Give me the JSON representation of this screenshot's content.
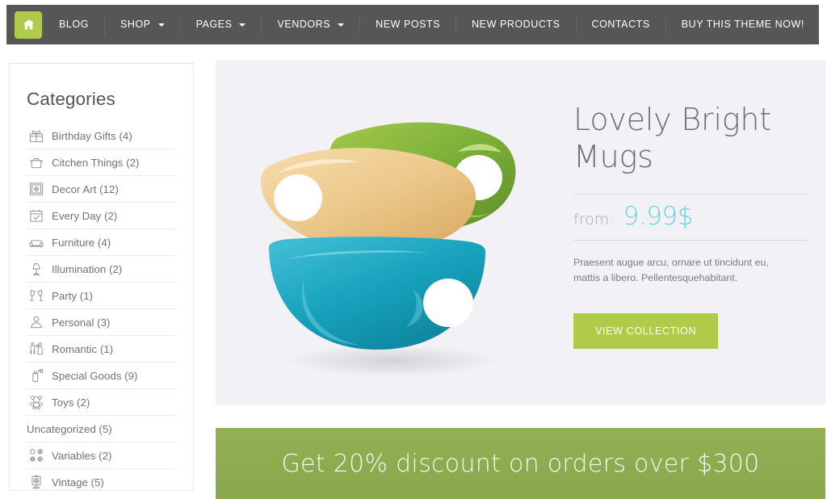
{
  "nav": {
    "home_icon": "home-icon",
    "items": [
      {
        "label": "BLOG",
        "has_dropdown": false
      },
      {
        "label": "SHOP",
        "has_dropdown": true
      },
      {
        "label": "PAGES",
        "has_dropdown": true
      },
      {
        "label": "VENDORS",
        "has_dropdown": true
      },
      {
        "label": "NEW POSTS",
        "has_dropdown": false
      },
      {
        "label": "NEW PRODUCTS",
        "has_dropdown": false
      },
      {
        "label": "CONTACTS",
        "has_dropdown": false
      },
      {
        "label": "BUY THIS THEME NOW!",
        "has_dropdown": false
      }
    ]
  },
  "sidebar": {
    "title": "Categories",
    "categories": [
      {
        "label": "Birthday Gifts (4)",
        "icon": "gift-icon"
      },
      {
        "label": "Citchen Things (2)",
        "icon": "pot-icon"
      },
      {
        "label": "Decor Art (12)",
        "icon": "framed-picture-icon"
      },
      {
        "label": "Every Day (2)",
        "icon": "calendar-check-icon"
      },
      {
        "label": "Furniture (4)",
        "icon": "sofa-icon"
      },
      {
        "label": "Illumination (2)",
        "icon": "table-lamp-icon"
      },
      {
        "label": "Party (1)",
        "icon": "cheers-glasses-icon"
      },
      {
        "label": "Personal (3)",
        "icon": "person-icon"
      },
      {
        "label": "Romantic (1)",
        "icon": "couple-icon"
      },
      {
        "label": "Special Goods (9)",
        "icon": "spray-can-icon"
      },
      {
        "label": "Toys (2)",
        "icon": "teddy-bear-icon"
      },
      {
        "label": "Uncategorized (5)",
        "icon": ""
      },
      {
        "label": "Variables (2)",
        "icon": "color-swatches-icon"
      },
      {
        "label": "Vintage (5)",
        "icon": "vintage-camera-icon"
      }
    ]
  },
  "product": {
    "image_alt": "stacked-mugs-image",
    "title": "Lovely Bright Mugs",
    "price_prefix": "from:",
    "price": "9.99$",
    "description": "Praesent augue arcu, ornare ut tincidunt eu, mattis a libero. Pellentesquehabitant.",
    "cta_label": "VIEW COLLECTION"
  },
  "banner": {
    "text": "Get 20% discount on orders over $300"
  },
  "colors": {
    "nav_bg": "#565656",
    "accent_green": "#b0cb4a",
    "banner_green": "#8dab4f",
    "price_blue": "#6ecfe5",
    "panel_bg": "#f2f1f5"
  }
}
